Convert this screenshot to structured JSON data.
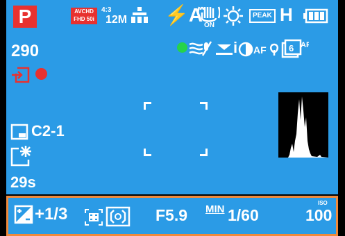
{
  "mode": {
    "label": "P"
  },
  "recording": {
    "format_line1": "AVCHD",
    "format_line2": "FHD 50i"
  },
  "aspect": {
    "ratio": "4:3",
    "size": "12M"
  },
  "flash_mode": "⚡A",
  "peaking": {
    "label": "PEAK",
    "level": "H"
  },
  "shots_remaining": "290",
  "custom_set": "C2-1",
  "self_timer": "29s",
  "bottom_bar": {
    "exposure_comp": "+1/3",
    "aperture": "F5.9",
    "min_label": "MIN",
    "shutter": "1/60",
    "iso_label": "ISO",
    "iso_value": "100"
  },
  "colors": {
    "view": "#2b9be6",
    "accent_red": "#e8312f",
    "bar_border": "#f08a3c",
    "green": "#26d34a"
  },
  "icons": [
    "mode-badge",
    "avchd-record-icon",
    "aspect-ratio-icon",
    "quality-icon",
    "flash-icon",
    "stabilizer-on-icon",
    "white-balance-sun-icon",
    "peaking-icon",
    "battery-icon",
    "green-status-dot",
    "wind-cut-icon",
    "level-icon",
    "i-dynamic-icon",
    "af-macro-icon",
    "af-mode-icon",
    "card-write-icon",
    "record-dot",
    "metering-display-icon",
    "self-timer-icon",
    "histogram",
    "exposure-comp-icon",
    "af-area-icon",
    "metering-icon"
  ]
}
